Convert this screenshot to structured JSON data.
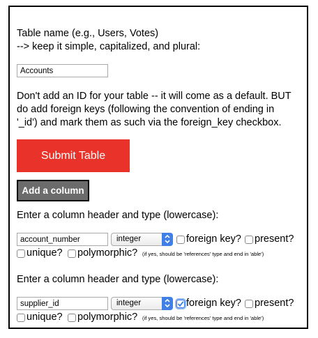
{
  "table_name": {
    "label_line1": "Table name (e.g., Users, Votes)",
    "label_line2": "--> keep it simple, capitalized, and plural:",
    "value": "Accounts"
  },
  "instructions": {
    "line1": "Don't add an ID for your table -- it will come as a default. BUT",
    "line2": "do add foreign keys (following the convention of ending in",
    "line3": "'_id') and mark them as such via the foreign_key checkbox."
  },
  "buttons": {
    "submit_label": "Submit Table",
    "add_column_label": "Add a column"
  },
  "colors": {
    "submit_bg": "#e8322a",
    "add_column_bg": "#6b6b6b",
    "select_accent": "#3f7fe6"
  },
  "columns": [
    {
      "header_label": "Enter a column header and type (lowercase):",
      "name_value": "account_number",
      "type_value": "integer",
      "foreign_key_label": "foreign key?",
      "foreign_key_checked": false,
      "present_label": "present?",
      "present_checked": false,
      "unique_label": "unique?",
      "unique_checked": false,
      "polymorphic_label": "polymorphic?",
      "polymorphic_checked": false,
      "polymorphic_hint": "(if yes, should be 'references' type and end in 'able')"
    },
    {
      "header_label": "Enter a column header and type (lowercase):",
      "name_value": "supplier_id",
      "type_value": "integer",
      "foreign_key_label": "foreign key?",
      "foreign_key_checked": true,
      "present_label": "present?",
      "present_checked": false,
      "unique_label": "unique?",
      "unique_checked": false,
      "polymorphic_label": "polymorphic?",
      "polymorphic_checked": false,
      "polymorphic_hint": "(if yes, should be 'references' type and end in 'able')"
    }
  ]
}
